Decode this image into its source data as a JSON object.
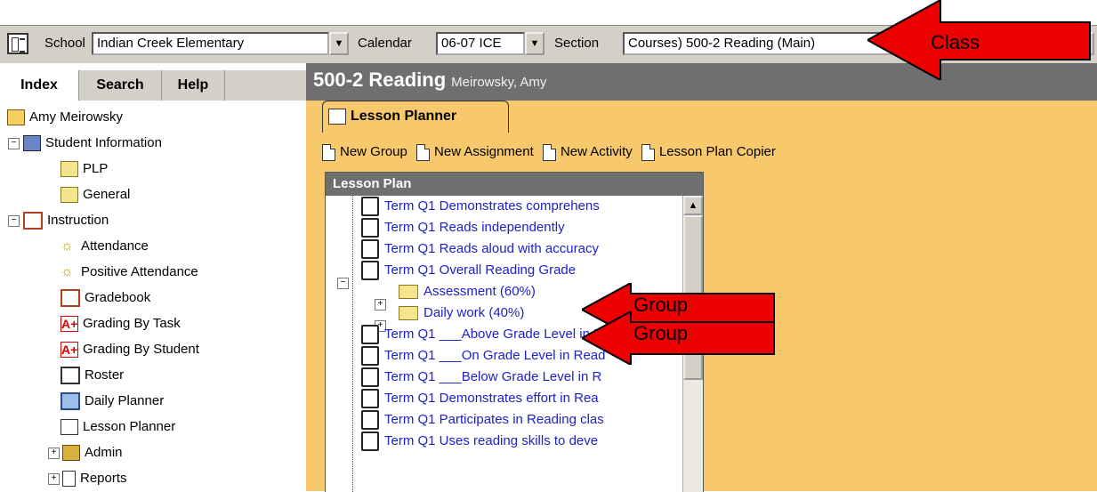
{
  "topbar": {
    "school_label": "School",
    "school_value": "Indian Creek Elementary",
    "calendar_label": "Calendar",
    "calendar_value": "06-07 ICE",
    "section_label": "Section",
    "section_value": "Courses) 500-2 Reading (Main)"
  },
  "nav": {
    "tabs": [
      "Index",
      "Search",
      "Help"
    ],
    "active_tab": "Index",
    "tree": [
      {
        "label": "Amy Meirowsky",
        "icon": "user-icon"
      },
      {
        "label": "Student Information",
        "icon": "student-info-icon",
        "expander": "−"
      },
      {
        "label": "PLP",
        "icon": "folder-icon"
      },
      {
        "label": "General",
        "icon": "folder-icon"
      },
      {
        "label": "Instruction",
        "icon": "instruction-icon",
        "expander": "−"
      },
      {
        "label": "Attendance",
        "icon": "attendance-icon"
      },
      {
        "label": "Positive Attendance",
        "icon": "attendance-icon"
      },
      {
        "label": "Gradebook",
        "icon": "gradebook-icon"
      },
      {
        "label": "Grading By Task",
        "icon": "grade-a-plus-icon"
      },
      {
        "label": "Grading By Student",
        "icon": "grade-a-plus-icon"
      },
      {
        "label": "Roster",
        "icon": "roster-icon"
      },
      {
        "label": "Daily Planner",
        "icon": "calendar-icon"
      },
      {
        "label": "Lesson Planner",
        "icon": "lesson-planner-icon"
      },
      {
        "label": "Admin",
        "icon": "admin-icon",
        "expander": "+"
      },
      {
        "label": "Reports",
        "icon": "document-icon",
        "expander": "+"
      }
    ]
  },
  "main": {
    "title": "500-2 Reading",
    "subtitle": "Meirowsky, Amy",
    "tab": "Lesson Planner",
    "toolbar": {
      "new_group": "New Group",
      "new_assignment": "New Assignment",
      "new_activity": "New Activity",
      "copier": "Lesson Plan Copier"
    },
    "lesson_plan": {
      "header": "Lesson Plan",
      "rows": [
        "Term Q1 Demonstrates comprehens",
        "Term Q1 Reads independently",
        "Term Q1 Reads aloud with accuracy",
        "Term Q1 Overall Reading Grade",
        "Assessment (60%)",
        "Daily work (40%)",
        "Term Q1 ___Above Grade Level in R",
        "Term Q1 ___On Grade Level in Read",
        "Term Q1 ___Below Grade Level in R",
        "Term Q1 Demonstrates effort in Rea",
        "Term Q1 Participates in Reading clas",
        "Term Q1 Uses reading skills to deve"
      ]
    }
  },
  "annotations": {
    "class": "Class",
    "group1": "Group",
    "group2": "Group",
    "arrow_color": "#ee0000"
  }
}
